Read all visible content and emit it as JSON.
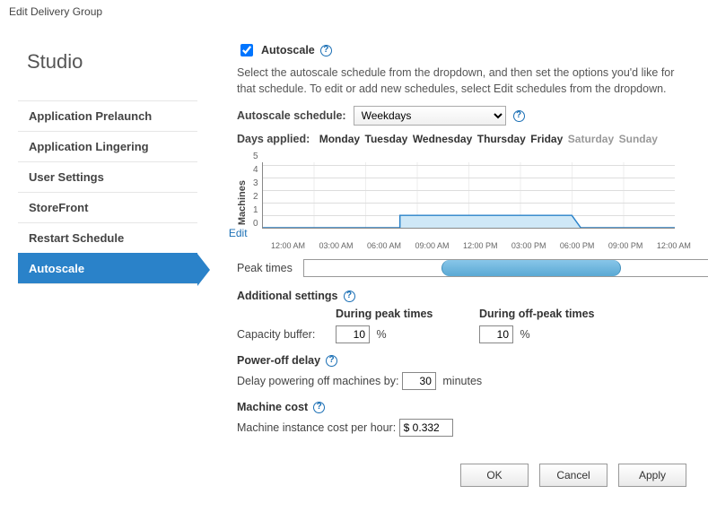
{
  "window_title": "Edit Delivery Group",
  "sidebar": {
    "title": "Studio",
    "items": [
      {
        "label": "Application Prelaunch"
      },
      {
        "label": "Application Lingering"
      },
      {
        "label": "User Settings"
      },
      {
        "label": "StoreFront"
      },
      {
        "label": "Restart Schedule"
      },
      {
        "label": "Autoscale"
      }
    ],
    "active_index": 5
  },
  "main": {
    "autoscale_checkbox_label": "Autoscale",
    "autoscale_checked": true,
    "description": "Select the autoscale schedule from the dropdown, and then set the options you'd like for that schedule. To edit or add new schedules, select Edit schedules from the dropdown.",
    "schedule_label": "Autoscale schedule:",
    "schedule_value": "Weekdays",
    "days_label": "Days applied:",
    "days": [
      {
        "name": "Monday",
        "active": true
      },
      {
        "name": "Tuesday",
        "active": true
      },
      {
        "name": "Wednesday",
        "active": true
      },
      {
        "name": "Thursday",
        "active": true
      },
      {
        "name": "Friday",
        "active": true
      },
      {
        "name": "Saturday",
        "active": false
      },
      {
        "name": "Sunday",
        "active": false
      }
    ],
    "chart": {
      "ylabel": "Machines",
      "yticks": [
        "0",
        "1",
        "2",
        "3",
        "4",
        "5"
      ],
      "xticks": [
        "12:00 AM",
        "03:00 AM",
        "06:00 AM",
        "09:00 AM",
        "12:00 PM",
        "03:00 PM",
        "06:00 PM",
        "09:00 PM",
        "12:00 AM"
      ],
      "edit_label": "Edit"
    },
    "peak_label": "Peak times",
    "peak_start_hour": 8,
    "peak_end_hour": 18.5,
    "additional_settings_title": "Additional settings",
    "col_peak": "During peak times",
    "col_offpeak": "During off-peak times",
    "capacity_label": "Capacity buffer:",
    "capacity_peak_value": "10",
    "capacity_offpeak_value": "10",
    "capacity_unit": "%",
    "poweroff_title": "Power-off delay",
    "poweroff_label": "Delay powering off machines by:",
    "poweroff_value": "30",
    "poweroff_unit": "minutes",
    "cost_title": "Machine cost",
    "cost_label": "Machine instance cost per hour:",
    "cost_value": "$ 0.332"
  },
  "chart_data": {
    "type": "line",
    "title": "",
    "xlabel": "",
    "ylabel": "Machines",
    "ylim": [
      0,
      5
    ],
    "x_hours": [
      0,
      1,
      2,
      3,
      4,
      5,
      6,
      7,
      8,
      9,
      10,
      11,
      12,
      13,
      14,
      15,
      16,
      17,
      18,
      19,
      20,
      21,
      22,
      23,
      24
    ],
    "categories": [
      "12:00 AM",
      "03:00 AM",
      "06:00 AM",
      "09:00 AM",
      "12:00 PM",
      "03:00 PM",
      "06:00 PM",
      "09:00 PM",
      "12:00 AM"
    ],
    "series": [
      {
        "name": "Machines",
        "values_by_hour": [
          0,
          0,
          0,
          0,
          0,
          0,
          0,
          0,
          1,
          1,
          1,
          1,
          1,
          1,
          1,
          1,
          1,
          1,
          0.5,
          0,
          0,
          0,
          0,
          0,
          0
        ]
      }
    ],
    "peak_window_hours": [
      8,
      18.5
    ]
  },
  "footer": {
    "ok": "OK",
    "cancel": "Cancel",
    "apply": "Apply"
  }
}
